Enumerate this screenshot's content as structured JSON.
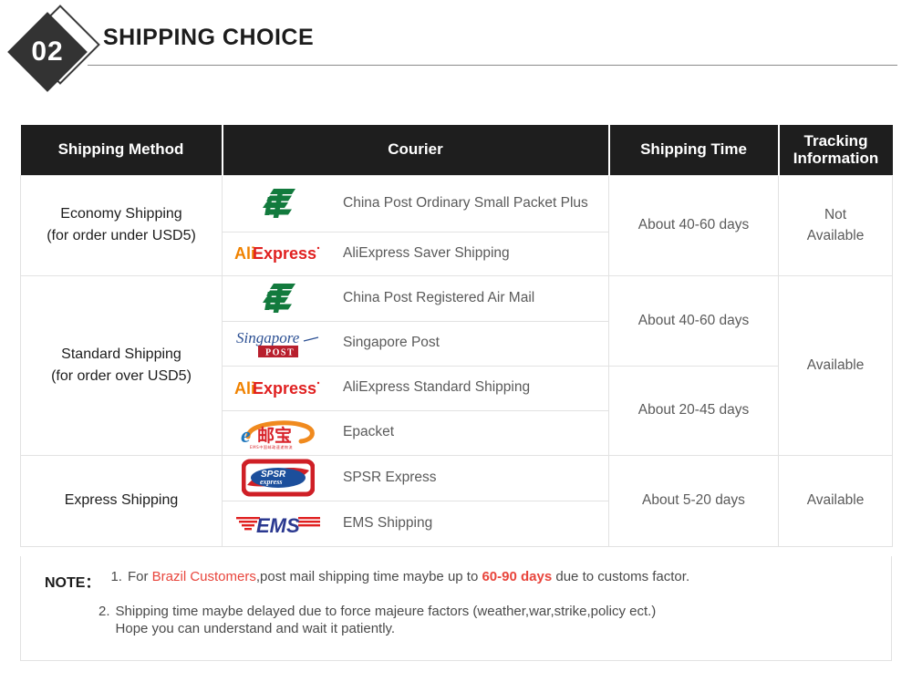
{
  "section": {
    "number": "02",
    "title": "SHIPPING CHOICE"
  },
  "table": {
    "headers": [
      {
        "label": "Shipping Method",
        "name": "shipping-method"
      },
      {
        "label": "Courier",
        "name": "courier"
      },
      {
        "label": "Shipping Time",
        "name": "shipping-time"
      },
      {
        "label": "Tracking Information",
        "name": "tracking-information"
      }
    ],
    "header_tracking_line1": "Tracking",
    "header_tracking_line2": "Information",
    "methods": {
      "economy_line1": "Economy Shipping",
      "economy_line2": "(for order under USD5)",
      "standard_line1": "Standard Shipping",
      "standard_line2": "(for order over USD5)",
      "express_line1": "Express Shipping"
    },
    "couriers": {
      "china_post_small_packet": "China Post Ordinary Small Packet Plus",
      "aliexpress_saver": "AliExpress Saver Shipping",
      "china_post_registered": "China Post Registered Air Mail",
      "singapore_post": "Singapore Post",
      "aliexpress_standard": "AliExpress Standard Shipping",
      "epacket": "Epacket",
      "spsr_express": "SPSR Express",
      "ems_shipping": "EMS Shipping"
    },
    "logos": {
      "china_post": "china-post-logo",
      "aliexpress": "aliexpress-logo",
      "singapore_post": "singapore-post-logo",
      "epacket": "epacket-logo",
      "spsr": "spsr-express-logo",
      "ems": "ems-logo"
    },
    "logo_text": {
      "aliexpress_ali": "Ali",
      "aliexpress_express": "Express",
      "singapore_script": "Singapore",
      "singapore_post_box": "POST",
      "epacket_e": "e",
      "epacket_cn": "邮宝",
      "spsr_name": "SPSR",
      "spsr_sub": "express",
      "ems_name": "EMS"
    },
    "times": {
      "economy": "About 40-60 days",
      "standard_a": "About 40-60 days",
      "standard_b": "About 20-45 days",
      "express": "About 5-20 days"
    },
    "tracking": {
      "economy_line1": "Not",
      "economy_line2": "Available",
      "standard": "Available",
      "express": "Available"
    }
  },
  "note": {
    "label": "NOTE：",
    "item1_index": "1.",
    "item1_part1": "For ",
    "item1_highlight1": "Brazil Customers",
    "item1_part2": ",post mail shipping time maybe up to ",
    "item1_highlight2": "60-90 days",
    "item1_part3": " due to customs factor.",
    "item2_index": "2.",
    "item2_line1": "Shipping time maybe delayed due to force majeure factors (weather,war,strike,policy ect.)",
    "item2_line2": "Hope you can understand and wait it patiently."
  },
  "colors": {
    "header_bg": "#1e1e1e",
    "accent_red": "#e8453c",
    "china_post_green": "#127a3d",
    "aliexpress_orange": "#f08200",
    "aliexpress_red": "#e02020",
    "singapore_blue": "#2b4f93",
    "singapore_red": "#b81f2d",
    "epacket_blue": "#1e77bd",
    "epacket_orange": "#f08a1e",
    "epacket_red": "#d8232a",
    "spsr_red": "#cf1f26",
    "spsr_blue": "#1c4f9c",
    "ems_blue": "#2b3990",
    "ems_red": "#e02020"
  }
}
